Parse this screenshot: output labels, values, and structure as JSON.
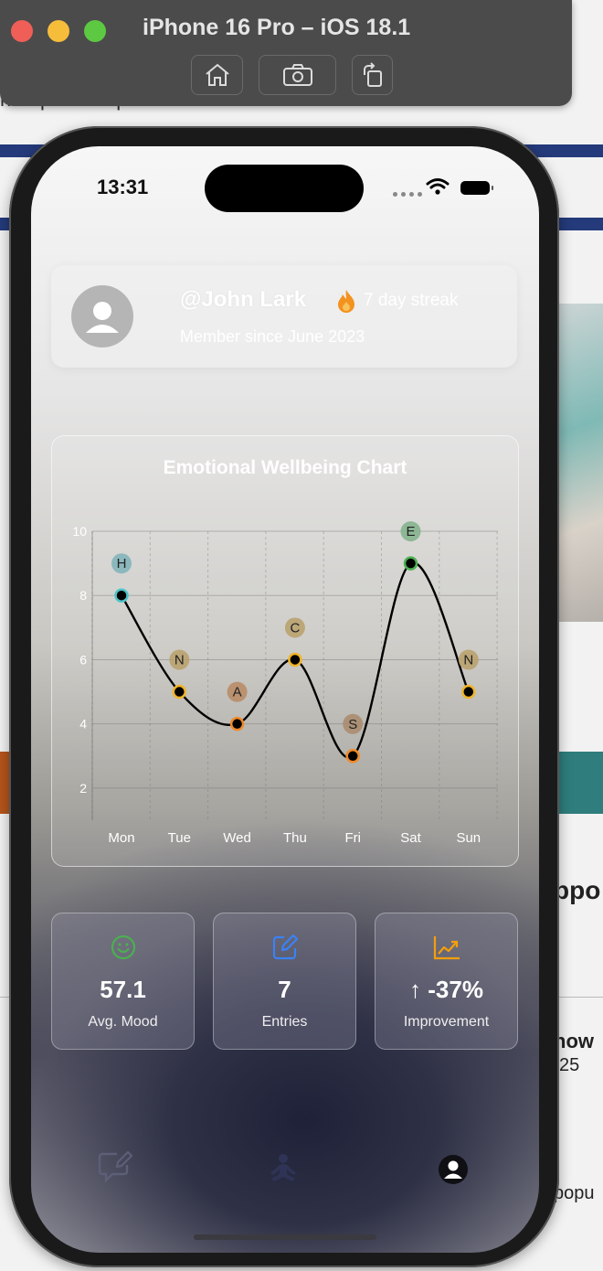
{
  "simulator": {
    "title": "iPhone 16 Pro – iOS 18.1",
    "buttons": [
      "home-icon",
      "screenshot-icon",
      "rotate-icon"
    ]
  },
  "background_page": {
    "fragments": [
      "harepointtiaepx",
      "ppo",
      "how",
      "25",
      "popu"
    ]
  },
  "status_bar": {
    "time": "13:31"
  },
  "profile": {
    "username": "@John Lark",
    "streak": "7 day streak",
    "member_since": "Member since June 2023"
  },
  "chart": {
    "title": "Emotional Wellbeing Chart"
  },
  "chart_data": {
    "type": "line",
    "title": "Emotional Wellbeing Chart",
    "categories": [
      "Mon",
      "Tue",
      "Wed",
      "Thu",
      "Fri",
      "Sat",
      "Sun"
    ],
    "values": [
      8,
      5,
      4,
      6,
      3,
      9,
      5
    ],
    "point_labels": [
      "H",
      "N",
      "A",
      "C",
      "S",
      "E",
      "N"
    ],
    "label_colors": [
      "#7fb3b8",
      "#b9a06a",
      "#b98a63",
      "#b9a06a",
      "#a98a6c",
      "#7fb08a",
      "#b9a06a"
    ],
    "point_colors": [
      "#4fc3c8",
      "#f0b429",
      "#f08a2a",
      "#f0b429",
      "#f08a2a",
      "#4caf50",
      "#f0b429"
    ],
    "y_ticks": [
      2,
      4,
      6,
      8,
      10
    ],
    "ylim": [
      1,
      10
    ],
    "grid": true,
    "curve": "smooth"
  },
  "stats": [
    {
      "icon": "smile-icon",
      "value": "57.1",
      "label": "Avg. Mood",
      "color": "#4caf50"
    },
    {
      "icon": "edit-icon",
      "value": "7",
      "label": "Entries",
      "color": "#3b82f6"
    },
    {
      "icon": "trend-up-icon",
      "value": "↑ -37%",
      "label": "Improvement",
      "color": "#f59e0b"
    }
  ],
  "tabbar": {
    "items": [
      "chat-icon",
      "meditation-icon",
      "profile-icon"
    ]
  }
}
